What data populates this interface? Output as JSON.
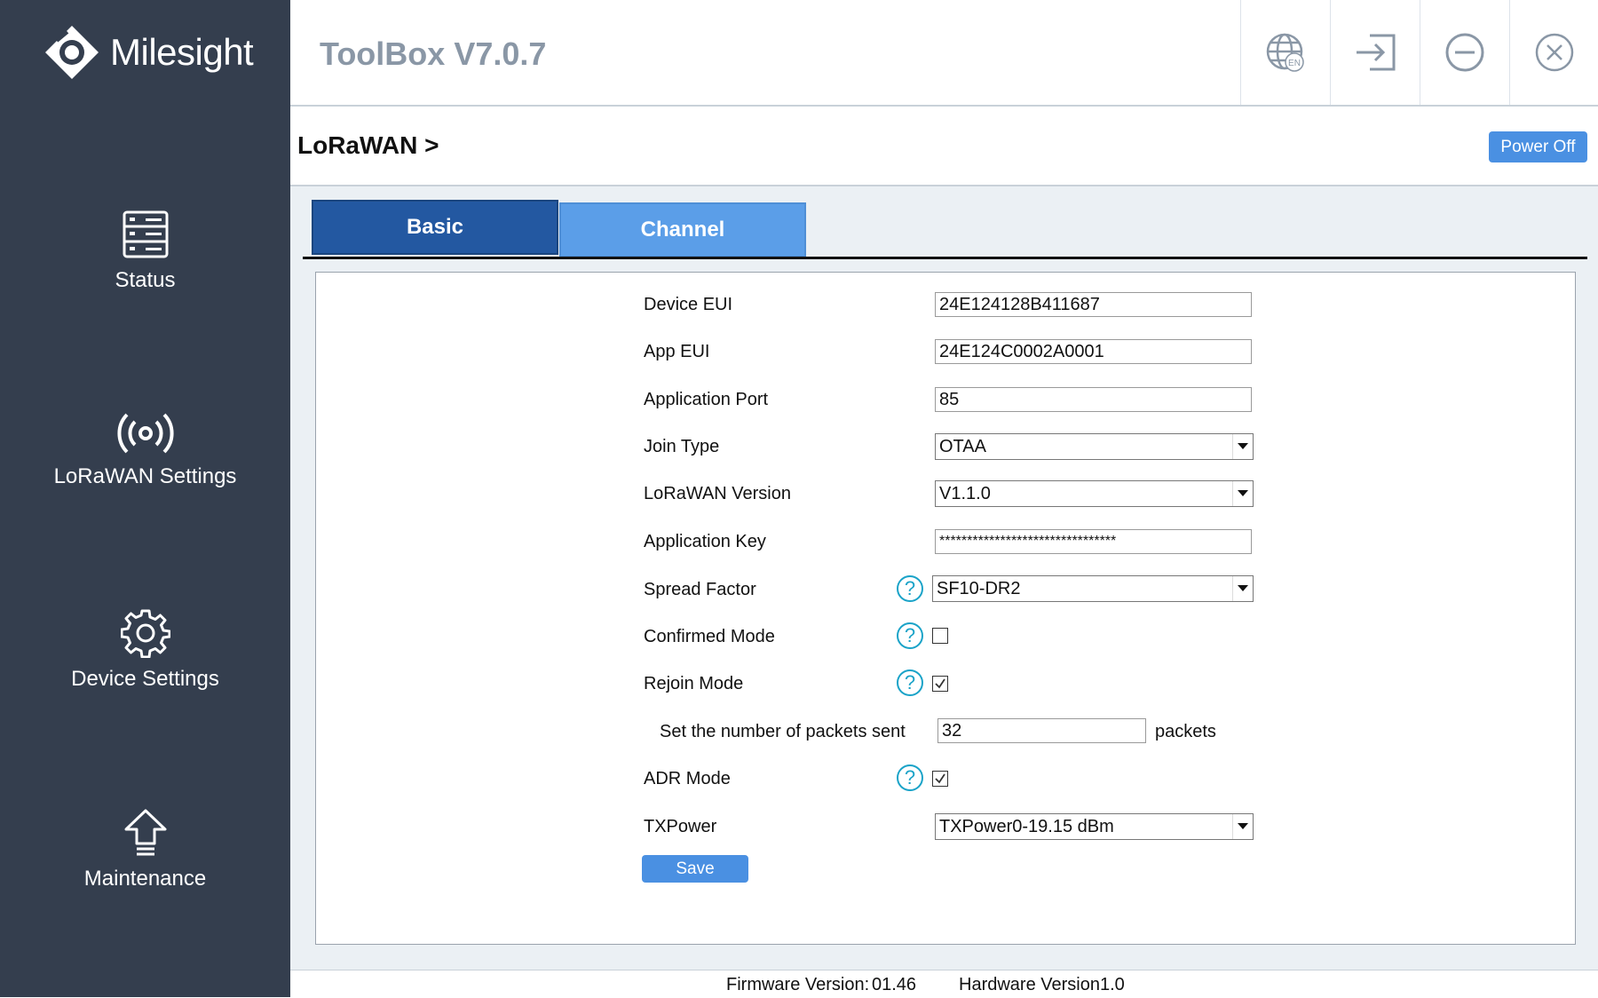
{
  "brand": {
    "name": "Milesight"
  },
  "sidebar": {
    "items": [
      {
        "label": "Status",
        "icon": "status-icon"
      },
      {
        "label": "LoRaWAN Settings",
        "icon": "wireless-signal-icon"
      },
      {
        "label": "Device Settings",
        "icon": "gear-icon"
      },
      {
        "label": "Maintenance",
        "icon": "upload-arrow-icon"
      }
    ]
  },
  "header": {
    "title": "ToolBox V7.0.7",
    "buttons": [
      {
        "icon": "language-globe-icon",
        "badge": "EN"
      },
      {
        "icon": "logout-icon"
      },
      {
        "icon": "minimize-icon"
      },
      {
        "icon": "close-icon"
      }
    ]
  },
  "subheader": {
    "breadcrumb": "LoRaWAN >",
    "power_label": "Power Off"
  },
  "tabs": [
    {
      "label": "Basic",
      "active": true
    },
    {
      "label": "Channel",
      "active": false
    }
  ],
  "form": {
    "device_eui": {
      "label": "Device EUI",
      "value": "24E124128B411687"
    },
    "app_eui": {
      "label": "App EUI",
      "value": "24E124C0002A0001"
    },
    "app_port": {
      "label": "Application Port",
      "value": "85"
    },
    "join_type": {
      "label": "Join Type",
      "value": "OTAA"
    },
    "lorawan_version": {
      "label": "LoRaWAN Version",
      "value": "V1.1.0"
    },
    "app_key": {
      "label": "Application Key",
      "value": "********************************"
    },
    "spread_factor": {
      "label": "Spread Factor",
      "value": "SF10-DR2"
    },
    "confirmed_mode": {
      "label": "Confirmed Mode",
      "checked": false
    },
    "rejoin_mode": {
      "label": "Rejoin Mode",
      "checked": true
    },
    "packets": {
      "label": "Set the number of packets sent",
      "value": "32",
      "unit": "packets"
    },
    "adr_mode": {
      "label": "ADR Mode",
      "checked": true
    },
    "txpower": {
      "label": "TXPower",
      "value": "TXPower0-19.15 dBm"
    },
    "help_glyph": "?",
    "save_label": "Save"
  },
  "footer": {
    "firmware_label": "Firmware Version:",
    "firmware_value": "01.46",
    "hardware_label": "Hardware Version",
    "hardware_value": "1.0"
  },
  "colors": {
    "sidebar_bg": "#343e4e",
    "accent": "#4a90e2",
    "tab_active": "#2358a1",
    "tab_inactive": "#5b9ee8",
    "help": "#1aa3c8"
  }
}
